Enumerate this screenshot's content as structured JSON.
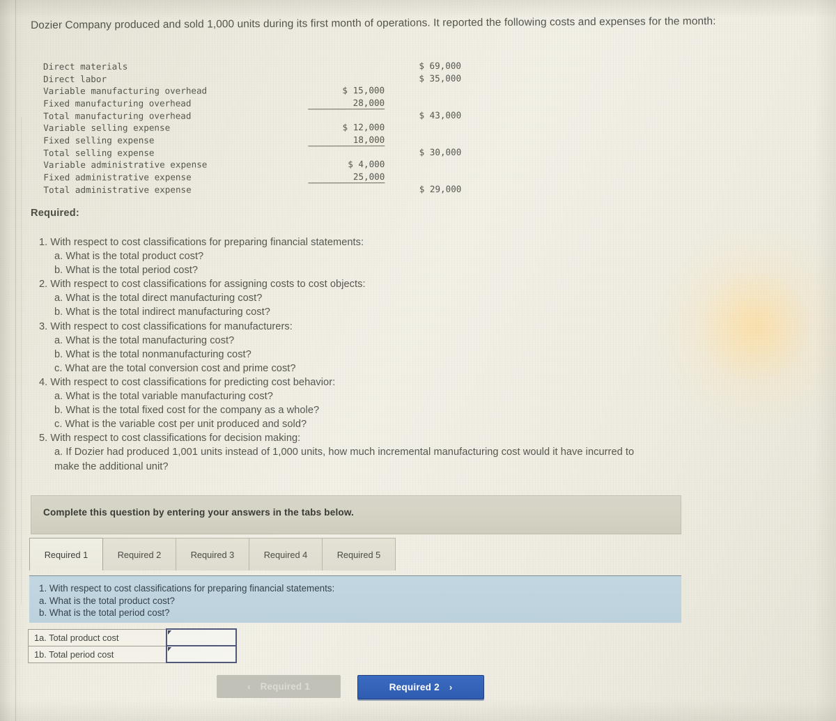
{
  "intro": {
    "text": "Dozier Company produced and sold 1,000 units during its first month of operations. It reported the following costs and expenses for the month:"
  },
  "cost_table": {
    "rows": [
      {
        "label": "Direct materials",
        "sub": "",
        "total": "$ 69,000",
        "rule": false
      },
      {
        "label": "Direct labor",
        "sub": "",
        "total": "$ 35,000",
        "rule": false
      },
      {
        "label": "Variable manufacturing overhead",
        "sub": "$ 15,000",
        "total": "",
        "rule": false
      },
      {
        "label": "Fixed manufacturing overhead",
        "sub": "28,000",
        "total": "",
        "rule": true
      },
      {
        "label": "Total manufacturing overhead",
        "sub": "",
        "total": "$ 43,000",
        "rule": false
      },
      {
        "label": "Variable selling expense",
        "sub": "$ 12,000",
        "total": "",
        "rule": false
      },
      {
        "label": "Fixed selling expense",
        "sub": "18,000",
        "total": "",
        "rule": true
      },
      {
        "label": "Total selling expense",
        "sub": "",
        "total": "$ 30,000",
        "rule": false
      },
      {
        "label": "Variable administrative expense",
        "sub": "$ 4,000",
        "total": "",
        "rule": false
      },
      {
        "label": "Fixed administrative expense",
        "sub": "25,000",
        "total": "",
        "rule": true
      },
      {
        "label": "Total administrative expense",
        "sub": "",
        "total": "$ 29,000",
        "rule": false
      }
    ]
  },
  "required": {
    "heading": "Required:",
    "items": [
      {
        "level": 1,
        "text": "1. With respect to cost classifications for preparing financial statements:"
      },
      {
        "level": 2,
        "text": "a. What is the total product cost?"
      },
      {
        "level": 2,
        "text": "b. What is the total period cost?"
      },
      {
        "level": 1,
        "text": "2. With respect to cost classifications for assigning costs to cost objects:"
      },
      {
        "level": 2,
        "text": "a. What is the total direct manufacturing cost?"
      },
      {
        "level": 2,
        "text": "b. What is the total indirect manufacturing cost?"
      },
      {
        "level": 1,
        "text": "3. With respect to cost classifications for manufacturers:"
      },
      {
        "level": 2,
        "text": "a. What is the total manufacturing cost?"
      },
      {
        "level": 2,
        "text": "b. What is the total nonmanufacturing cost?"
      },
      {
        "level": 2,
        "text": "c. What are the total conversion cost and prime cost?"
      },
      {
        "level": 1,
        "text": "4. With respect to cost classifications for predicting cost behavior:"
      },
      {
        "level": 2,
        "text": "a. What is the total variable manufacturing cost?"
      },
      {
        "level": 2,
        "text": "b. What is the total fixed cost for the company as a whole?"
      },
      {
        "level": 2,
        "text": "c. What is the variable cost per unit produced and sold?"
      },
      {
        "level": 1,
        "text": "5. With respect to cost classifications for decision making:"
      },
      {
        "level": 2,
        "text": "a. If Dozier had produced 1,001 units instead of 1,000 units, how much incremental manufacturing cost would it have incurred to"
      },
      {
        "level": 3,
        "text": "make the additional unit?"
      }
    ]
  },
  "banner": {
    "text": "Complete this question by entering your answers in the tabs below."
  },
  "tabs": [
    {
      "label": "Required 1",
      "active": true
    },
    {
      "label": "Required 2",
      "active": false
    },
    {
      "label": "Required 3",
      "active": false
    },
    {
      "label": "Required 4",
      "active": false
    },
    {
      "label": "Required 5",
      "active": false
    }
  ],
  "blue_panel": {
    "line1": "1. With respect to cost classifications for preparing financial statements:",
    "line2": "a. What is the total product cost?",
    "line3": "b. What is the total period cost?"
  },
  "answer_table": {
    "rows": [
      {
        "label": "1a. Total product cost",
        "value": ""
      },
      {
        "label": "1b. Total period cost",
        "value": ""
      }
    ]
  },
  "navigation": {
    "prev_label": "Required 1",
    "prev_chevron": "‹",
    "prev_disabled": true,
    "next_label": "Required 2",
    "next_chevron": "›"
  },
  "colors": {
    "page_background": "#ece9de",
    "banner_background": "#d5d3c5",
    "blue_panel": "#bfd4df",
    "next_button": "#2f5cb0",
    "prev_button_disabled": "#c2c1b7",
    "input_border": "#51597a"
  }
}
